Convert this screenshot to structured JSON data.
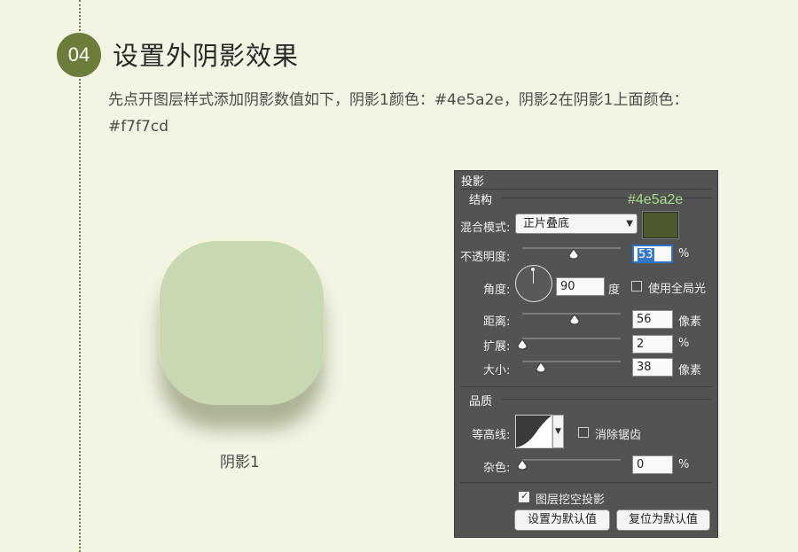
{
  "step": {
    "number": "04",
    "title": "设置外阴影效果"
  },
  "description": "先点开图层样式添加阴影数值如下，阴影1颜色：#4e5a2e，阴影2在阴影1上面颜色：#f7f7cd",
  "preview": {
    "label": "阴影1"
  },
  "panel": {
    "title": "投影",
    "structure_heading": "结构",
    "color_label": "#4e5a2e",
    "blend_mode": {
      "label": "混合模式:",
      "value": "正片叠底",
      "swatch_color": "#4e5a2e"
    },
    "opacity": {
      "label": "不透明度:",
      "value": "53",
      "unit": "%",
      "slider_fraction": 0.53
    },
    "angle": {
      "label": "角度:",
      "value": "90",
      "unit": "度",
      "global_light_label": "使用全局光",
      "global_light_checked": false
    },
    "distance": {
      "label": "距离:",
      "value": "56",
      "unit": "像素"
    },
    "spread": {
      "label": "扩展:",
      "value": "2",
      "unit": "%"
    },
    "size": {
      "label": "大小:",
      "value": "38",
      "unit": "像素"
    },
    "quality_heading": "品质",
    "contour": {
      "label": "等高线:",
      "antialias_label": "消除锯齿",
      "antialias_checked": false
    },
    "noise": {
      "label": "杂色:",
      "value": "0",
      "unit": "%"
    },
    "knockout": {
      "label": "图层挖空投影",
      "checked": true
    },
    "buttons": {
      "set_default": "设置为默认值",
      "reset_default": "复位为默认值"
    }
  }
}
